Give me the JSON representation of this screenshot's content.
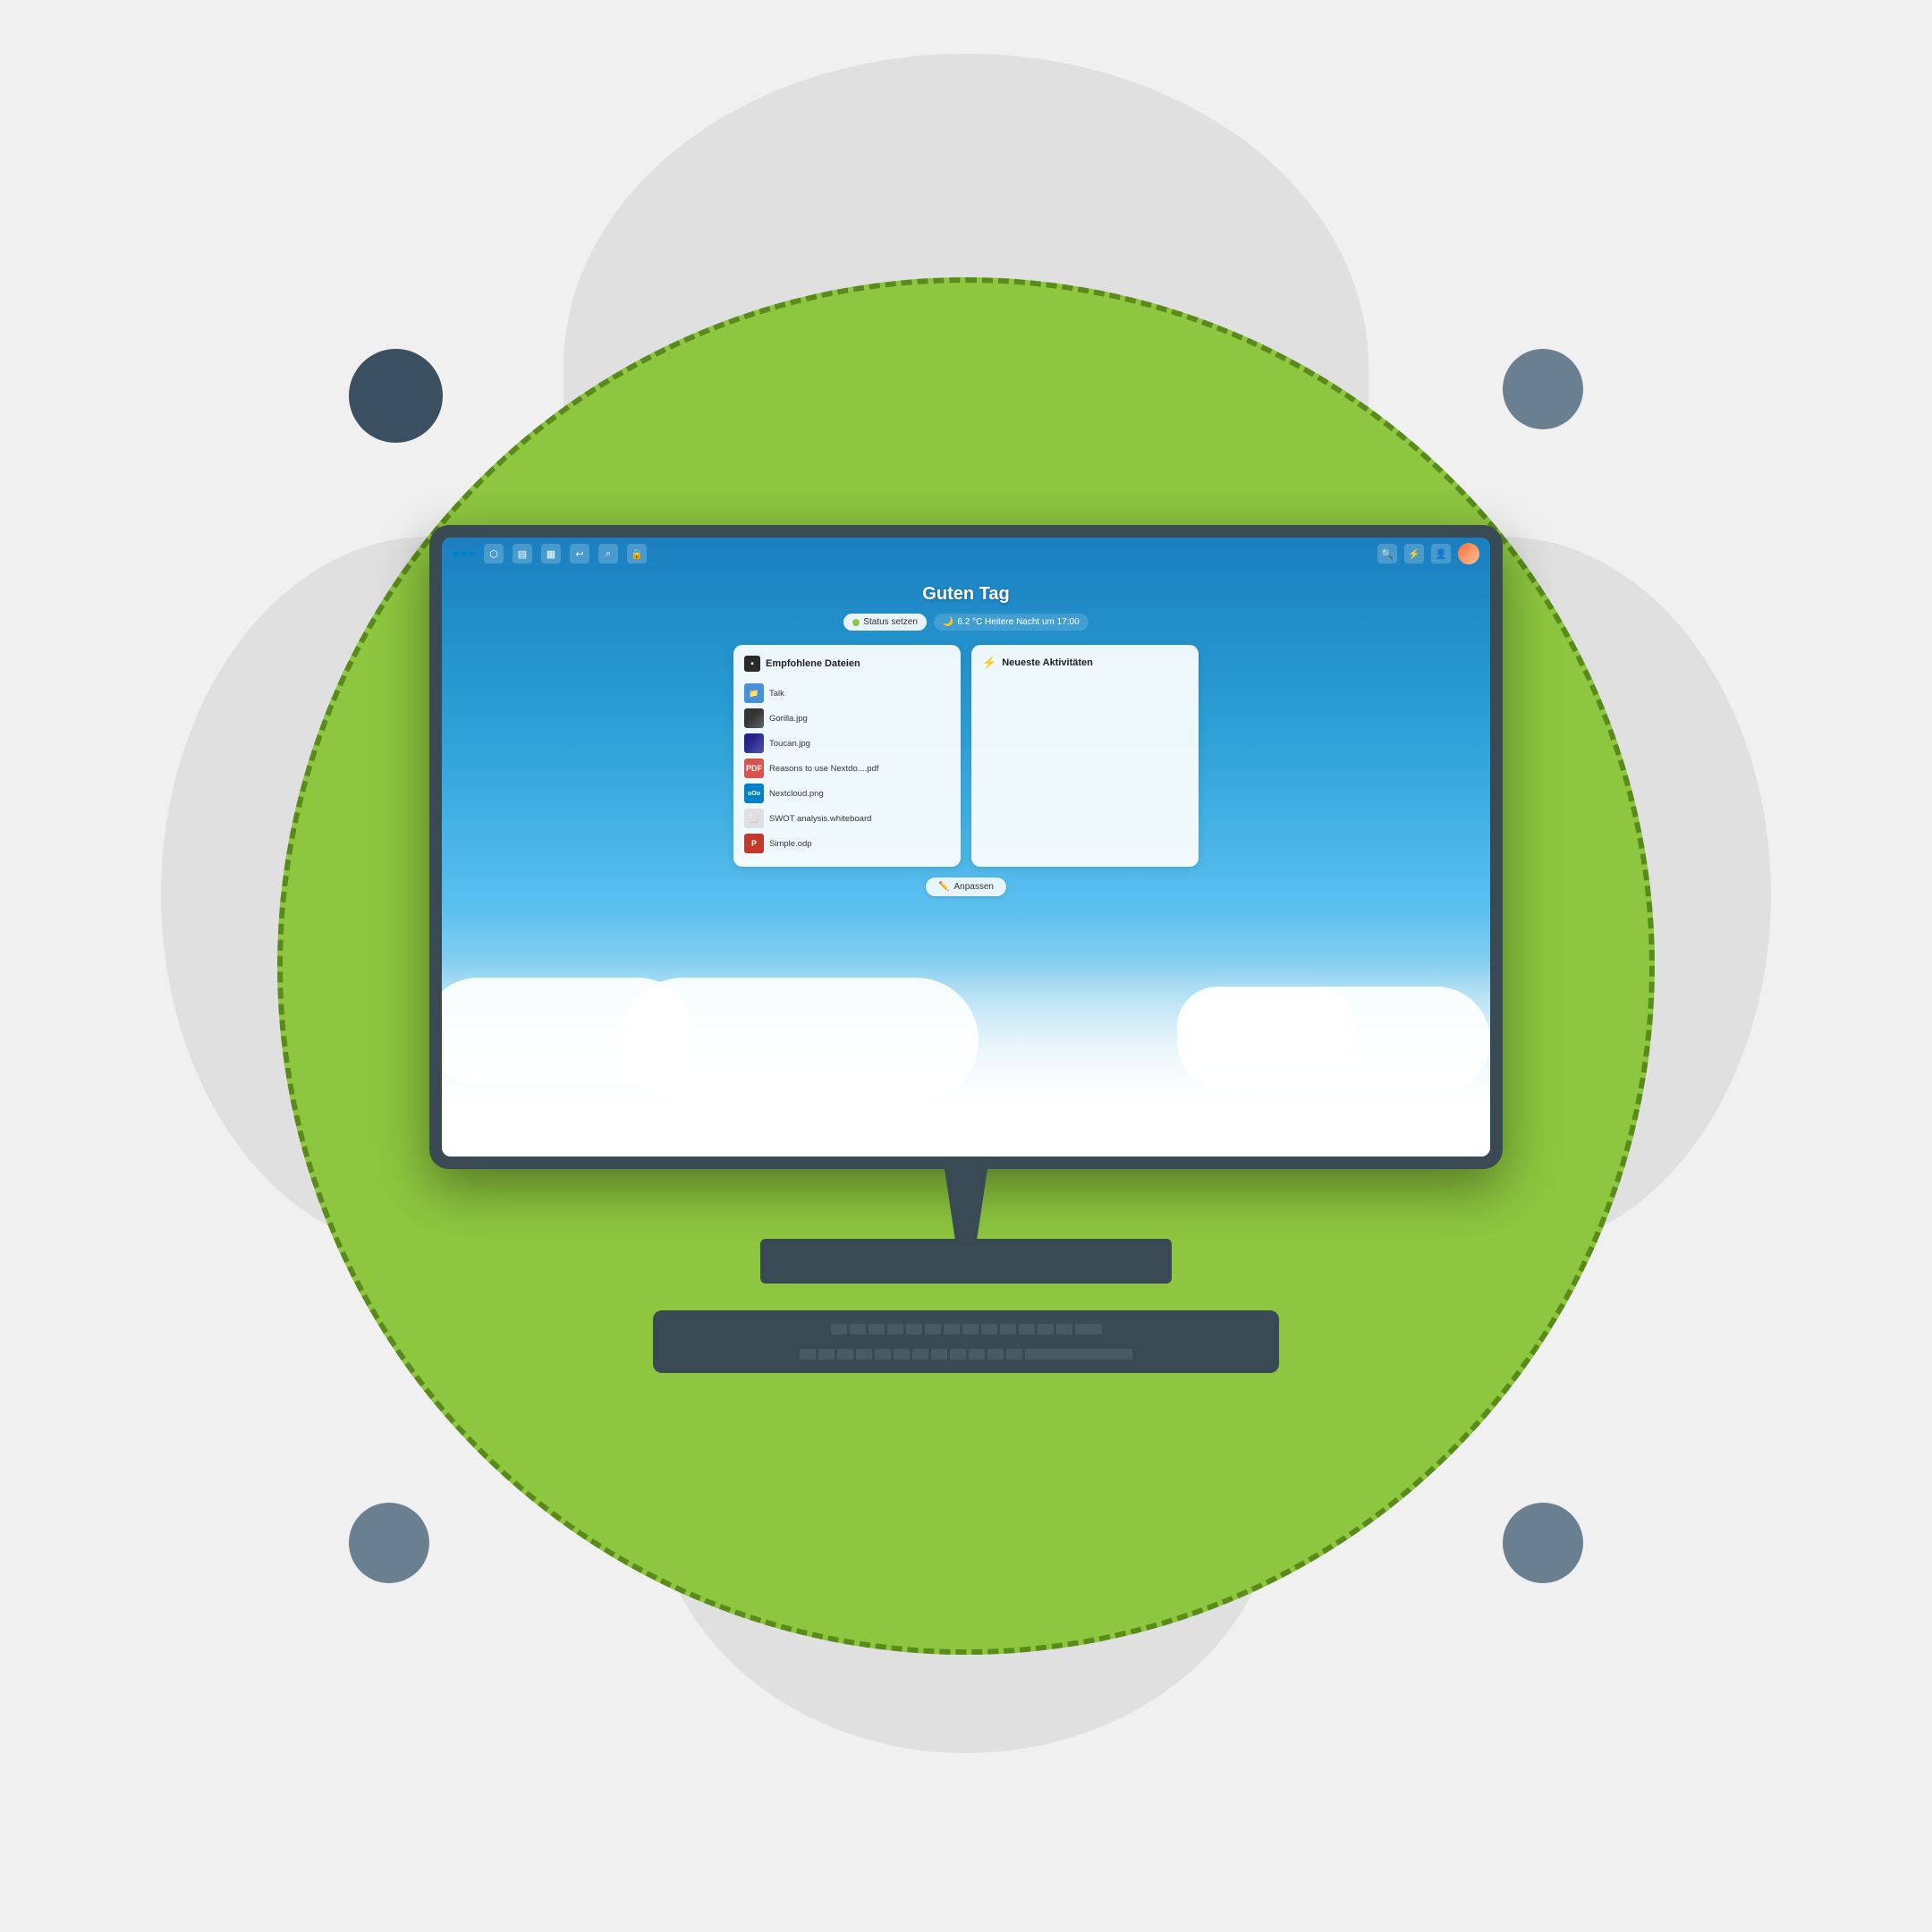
{
  "page": {
    "background_color": "#f0f0f0"
  },
  "topbar": {
    "logo_alt": "Nextcloud logo",
    "nav_icons": [
      "files",
      "photos",
      "calendar",
      "undo",
      "search",
      "lock"
    ],
    "right_icons": [
      "search",
      "bolt",
      "person",
      "avatar"
    ]
  },
  "screen": {
    "greeting": "Guten Tag",
    "status_button": "Status setzen",
    "weather": "6.2 °C Heitere Nacht um 17:00",
    "panels": {
      "files": {
        "title": "Empfohlene Dateien",
        "items": [
          {
            "name": "Talk",
            "type": "folder",
            "ext": ""
          },
          {
            "name": "Gorilla.jpg",
            "type": "image",
            "ext": "jpg"
          },
          {
            "name": "Toucan.jpg",
            "type": "image",
            "ext": "jpg"
          },
          {
            "name": "Reasons to use Nextdo....pdf",
            "type": "pdf",
            "ext": "pdf"
          },
          {
            "name": "Nextcloud.png",
            "type": "nc",
            "ext": "png"
          },
          {
            "name": "SWOT analysis.whiteboard",
            "type": "whiteboard",
            "ext": "whiteboard"
          },
          {
            "name": "Simple.odp",
            "type": "odp",
            "ext": "odp"
          }
        ]
      },
      "activities": {
        "title": "Neueste Aktivitäten"
      }
    },
    "customize_button": "Anpassen"
  }
}
